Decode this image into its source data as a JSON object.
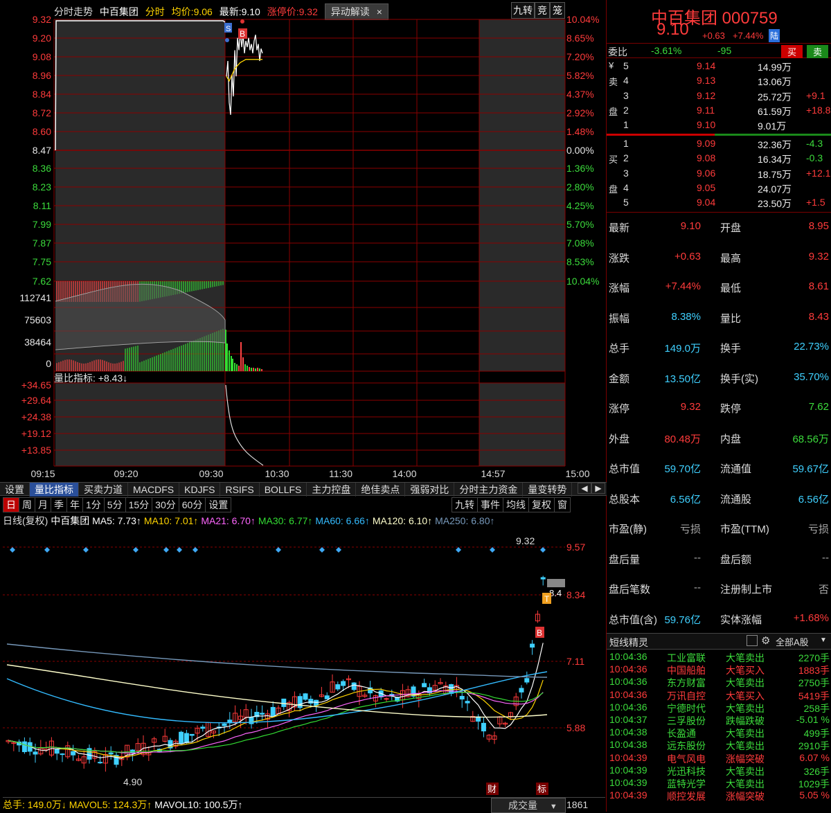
{
  "header": {
    "title": "分时走势",
    "stock": "中百集团",
    "mode": "分时",
    "avg_label": "均价:",
    "avg": "9.06",
    "last_label": "最新:",
    "last": "9.10",
    "limit_label": "涨停价:",
    "limit": "9.32",
    "tag": "异动解读",
    "close": "×"
  },
  "top_buttons": [
    "九转",
    "竞",
    "笼"
  ],
  "left_y": [
    "9.32",
    "9.20",
    "9.08",
    "8.96",
    "8.84",
    "8.72",
    "8.60",
    "8.47",
    "8.36",
    "8.23",
    "8.11",
    "7.99",
    "7.87",
    "7.75",
    "7.62"
  ],
  "right_pct": [
    "10.04%",
    "8.65%",
    "7.20%",
    "5.82%",
    "4.37%",
    "2.92%",
    "1.48%",
    "0.00%",
    "1.36%",
    "2.80%",
    "4.25%",
    "5.70%",
    "7.08%",
    "8.53%",
    "10.04%"
  ],
  "vol_y": [
    "112741",
    "75603",
    "38464",
    "0"
  ],
  "lb": {
    "label": "量比指标:",
    "value": "+8.43↓",
    "y": [
      "+34.65",
      "+29.64",
      "+24.38",
      "+19.12",
      "+13.85"
    ]
  },
  "time_axis": [
    "09:15",
    "09:20",
    "09:30",
    "10:30",
    "11:30",
    "14:00",
    "14:57",
    "15:00"
  ],
  "markers": {
    "s": "S",
    "b": "B",
    "t": "T"
  },
  "tabs": [
    "设置",
    "量比指标",
    "买卖力道",
    "MACDFS",
    "KDJFS",
    "RSIFS",
    "BOLLFS",
    "主力控盘",
    "绝佳卖点",
    "强弱对比",
    "分时主力资金",
    "量变转势"
  ],
  "tab_arrows": [
    "◀",
    "▶"
  ],
  "periods": [
    "日",
    "周",
    "月",
    "季",
    "年",
    "1分",
    "5分",
    "15分",
    "30分",
    "60分",
    "设置"
  ],
  "kline_buttons": [
    "九转",
    "事件",
    "均线",
    "复权",
    "窗"
  ],
  "ma_line": {
    "prefix": "日线(复权)",
    "name": "中百集团",
    "ma5": "MA5: 7.73↑",
    "ma10": "MA10: 7.01↑",
    "ma21": "MA21: 6.70↑",
    "ma30": "MA30: 6.77↑",
    "ma60": "MA60: 6.66↑",
    "ma120": "MA120: 6.10↑",
    "ma250": "MA250: 6.80↑"
  },
  "kline_y": [
    "9.57",
    "8.34",
    "7.11",
    "5.88"
  ],
  "kline_labels": {
    "high": "9.32",
    "low": "4.90",
    "mark": "8.4",
    "cai": "财",
    "biao": "标"
  },
  "vol_footer": {
    "total": "总手: 149.0万↓",
    "mavol5": "MAVOL5: 124.3万↑",
    "mavol10": "MAVOL10: 100.5万↑",
    "sel": "成交量",
    "arrow": "▼",
    "num": "1861"
  },
  "quote": {
    "name": "中百集团 000759",
    "price": "9.10",
    "chg": "+0.63",
    "pct": "+7.44%",
    "tag": "陆"
  },
  "weibi": {
    "label": "委比",
    "pct": "-3.61%",
    "diff": "-95",
    "buy": "买",
    "sell": "卖"
  },
  "sells": [
    {
      "n": "5",
      "p": "9.14",
      "v": "14.99万",
      "d": ""
    },
    {
      "n": "4",
      "p": "9.13",
      "v": "13.06万",
      "d": ""
    },
    {
      "n": "3",
      "p": "9.12",
      "v": "25.72万",
      "d": "+9.1"
    },
    {
      "n": "2",
      "p": "9.11",
      "v": "61.59万",
      "d": "+18.8"
    },
    {
      "n": "1",
      "p": "9.10",
      "v": "9.01万",
      "d": ""
    }
  ],
  "sell_side": [
    "¥",
    "卖",
    "",
    "盘",
    ""
  ],
  "buys": [
    {
      "n": "1",
      "p": "9.09",
      "v": "32.36万",
      "d": "-4.3"
    },
    {
      "n": "2",
      "p": "9.08",
      "v": "16.34万",
      "d": "-0.3"
    },
    {
      "n": "3",
      "p": "9.06",
      "v": "18.75万",
      "d": "+12.1"
    },
    {
      "n": "4",
      "p": "9.05",
      "v": "24.07万",
      "d": ""
    },
    {
      "n": "5",
      "p": "9.04",
      "v": "23.50万",
      "d": "+1.5"
    }
  ],
  "buy_side": [
    "",
    "买",
    "",
    "盘",
    ""
  ],
  "stats": [
    {
      "l1": "最新",
      "v1": "9.10",
      "c1": "red",
      "l2": "开盘",
      "v2": "8.95",
      "c2": "red"
    },
    {
      "l1": "涨跌",
      "v1": "+0.63",
      "c1": "red",
      "l2": "最高",
      "v2": "9.32",
      "c2": "red"
    },
    {
      "l1": "涨幅",
      "v1": "+7.44%",
      "c1": "red",
      "l2": "最低",
      "v2": "8.61",
      "c2": "red"
    },
    {
      "l1": "振幅",
      "v1": "8.38%",
      "c1": "cyan",
      "l2": "量比",
      "v2": "8.43",
      "c2": "red"
    },
    {
      "l1": "总手",
      "v1": "149.0万",
      "c1": "cyan",
      "l2": "换手",
      "v2": "22.73%",
      "c2": "cyan"
    },
    {
      "l1": "金额",
      "v1": "13.50亿",
      "c1": "cyan",
      "l2": "换手(实)",
      "v2": "35.70%",
      "c2": "cyan"
    },
    {
      "l1": "涨停",
      "v1": "9.32",
      "c1": "red",
      "l2": "跌停",
      "v2": "7.62",
      "c2": "grn"
    },
    {
      "l1": "外盘",
      "v1": "80.48万",
      "c1": "red",
      "l2": "内盘",
      "v2": "68.56万",
      "c2": "grn"
    },
    {
      "l1": "总市值",
      "v1": "59.70亿",
      "c1": "cyan",
      "l2": "流通值",
      "v2": "59.67亿",
      "c2": "cyan"
    },
    {
      "l1": "总股本",
      "v1": "6.56亿",
      "c1": "cyan",
      "l2": "流通股",
      "v2": "6.56亿",
      "c2": "cyan"
    },
    {
      "l1": "市盈(静)",
      "v1": "亏损",
      "c1": "gry",
      "l2": "市盈(TTM)",
      "v2": "亏损",
      "c2": "gry"
    },
    {
      "l1": "盘后量",
      "v1": "--",
      "c1": "gry",
      "l2": "盘后额",
      "v2": "--",
      "c2": "gry"
    },
    {
      "l1": "盘后笔数",
      "v1": "--",
      "c1": "gry",
      "l2": "注册制上市",
      "v2": "否",
      "c2": "gry"
    },
    {
      "l1": "总市值(含)",
      "v1": "59.76亿",
      "c1": "cyan",
      "l2": "实体涨幅",
      "v2": "+1.68%",
      "c2": "red"
    }
  ],
  "flash": {
    "title": "短线精灵",
    "filter": "全部A股",
    "rows": [
      {
        "t": "10:04:36",
        "n": "工业富联",
        "e": "大笔卖出",
        "v": "2270手",
        "c": "grn"
      },
      {
        "t": "10:04:36",
        "n": "中国船舶",
        "e": "大笔买入",
        "v": "1883手",
        "c": "red"
      },
      {
        "t": "10:04:36",
        "n": "东方财富",
        "e": "大笔卖出",
        "v": "2750手",
        "c": "grn"
      },
      {
        "t": "10:04:36",
        "n": "万讯自控",
        "e": "大笔买入",
        "v": "5419手",
        "c": "red"
      },
      {
        "t": "10:04:36",
        "n": "宁德时代",
        "e": "大笔卖出",
        "v": "258手",
        "c": "grn"
      },
      {
        "t": "10:04:37",
        "n": "三孚股份",
        "e": "跌幅跌破",
        "v": "-5.01 %",
        "c": "grn"
      },
      {
        "t": "10:04:38",
        "n": "长盈通",
        "e": "大笔卖出",
        "v": "499手",
        "c": "grn"
      },
      {
        "t": "10:04:38",
        "n": "远东股份",
        "e": "大笔卖出",
        "v": "2910手",
        "c": "grn"
      },
      {
        "t": "10:04:39",
        "n": "电气风电",
        "e": "涨幅突破",
        "v": "6.07 %",
        "c": "red"
      },
      {
        "t": "10:04:39",
        "n": "光迅科技",
        "e": "大笔卖出",
        "v": "326手",
        "c": "grn"
      },
      {
        "t": "10:04:39",
        "n": "蓝特光学",
        "e": "大笔卖出",
        "v": "1029手",
        "c": "grn"
      },
      {
        "t": "10:04:39",
        "n": "顺控发展",
        "e": "涨幅突破",
        "v": "5.05 %",
        "c": "red"
      }
    ]
  },
  "colors": {
    "up": "#ff3b3b",
    "down": "#3cdc3c",
    "price": "#ffffff",
    "avg": "#ffd400",
    "grid": "#8b0000"
  },
  "kline_ma_colors": {
    "ma5": "#ffffff",
    "ma10": "#ffd400",
    "ma21": "#ff66ff",
    "ma30": "#33dd33",
    "ma60": "#33bbff",
    "ma120": "#ffffcc",
    "ma250": "#7799bb"
  }
}
